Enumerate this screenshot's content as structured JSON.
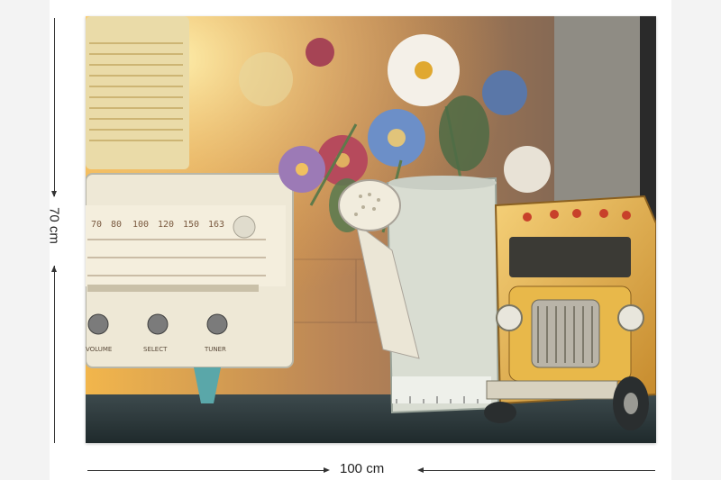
{
  "product": {
    "image_alt": "Canvas print: vintage radio, watering can with flowers and toy school bus",
    "height_label": "70 cm",
    "width_label": "100 cm",
    "radio_scale_top": [
      "70",
      "80",
      "100",
      "120",
      "150",
      "163"
    ],
    "radio_knob_labels": [
      "VOLUME",
      "SELECT",
      "TUNER"
    ]
  },
  "colors": {
    "background": "#f3f3f3",
    "warm_light": "#f4c35a",
    "radio_body": "#efe9d8",
    "bus_yellow": "#e9b43f"
  }
}
